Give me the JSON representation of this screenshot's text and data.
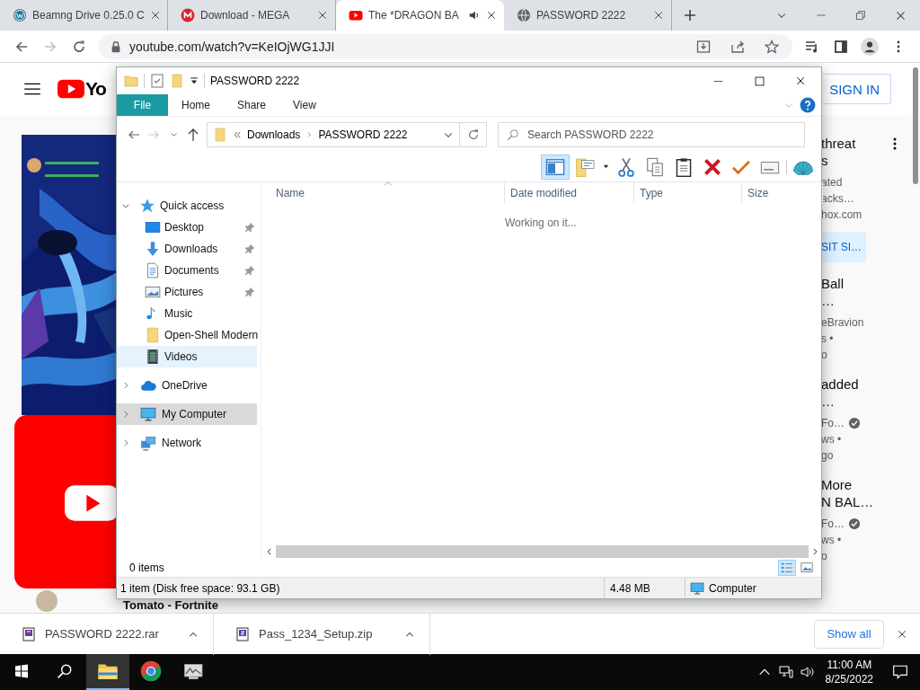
{
  "browser": {
    "tabs": [
      {
        "title": "Beamng Drive 0.25.0 C",
        "selected": false,
        "audio": false
      },
      {
        "title": "Download - MEGA",
        "selected": false,
        "audio": false
      },
      {
        "title": "The *DRAGON BA",
        "selected": true,
        "audio": true
      },
      {
        "title": "PASSWORD 2222",
        "selected": false,
        "audio": false
      }
    ],
    "address": "youtube.com/watch?v=KeIOjWG1JJI"
  },
  "youtube": {
    "logo_text": "Yo",
    "sign_in": "SIGN IN",
    "recommendations": [
      {
        "title": [
          "threat",
          "s"
        ],
        "lines": [
          "ated",
          "acks…",
          "hox.com"
        ],
        "button": "SIT SI…",
        "menu": true
      },
      {
        "title": [
          "Ball",
          "…"
        ],
        "lines": [
          "eBravion",
          "s •",
          "o"
        ]
      },
      {
        "title": [
          "added",
          "…"
        ],
        "lines": [
          "Fo…",
          "ws •",
          "go"
        ],
        "verified": true
      },
      {
        "title": [
          "More",
          "N BAL…"
        ],
        "lines": [
          "Fo…",
          "ws •",
          "o"
        ],
        "verified": true
      }
    ],
    "below_video": "Tomato - Fortnite"
  },
  "explorer": {
    "title": "PASSWORD 2222",
    "ribbon_tabs": [
      {
        "label": "File",
        "selected": true
      },
      {
        "label": "Home",
        "selected": false
      },
      {
        "label": "Share",
        "selected": false
      },
      {
        "label": "View",
        "selected": false
      }
    ],
    "breadcrumb": [
      "Downloads",
      "PASSWORD 2222"
    ],
    "search": {
      "placeholder": "Search PASSWORD 2222"
    },
    "preview_pane": true,
    "nav": [
      {
        "label": "Quick access",
        "expanded": true,
        "selected": false,
        "children": [
          {
            "label": "Desktop",
            "pinned": true,
            "selected": false,
            "hover": false
          },
          {
            "label": "Downloads",
            "pinned": true,
            "selected": false,
            "hover": false
          },
          {
            "label": "Documents",
            "pinned": true,
            "selected": false,
            "hover": false
          },
          {
            "label": "Pictures",
            "pinned": true,
            "selected": false,
            "hover": false
          },
          {
            "label": "Music",
            "pinned": false,
            "selected": false,
            "hover": false
          },
          {
            "label": "Open-Shell Modern",
            "pinned": false,
            "selected": false,
            "hover": false
          },
          {
            "label": "Videos",
            "pinned": false,
            "selected": false,
            "hover": true
          }
        ]
      },
      {
        "label": "OneDrive",
        "expanded": false,
        "selected": false
      },
      {
        "label": "My Computer",
        "expanded": false,
        "selected": true
      },
      {
        "label": "Network",
        "expanded": false,
        "selected": false
      }
    ],
    "columns": [
      "Name",
      "Date modified",
      "Type",
      "Size"
    ],
    "message": "Working on it...",
    "item_count": "0 items",
    "view_buttons": [
      {
        "selected": true
      },
      {
        "selected": false
      }
    ],
    "status": {
      "items": "1 item (Disk free space: 93.1 GB)",
      "size": "4.48 MB",
      "location": "Computer"
    }
  },
  "downloads": {
    "items": [
      {
        "name": "PASSWORD 2222.rar"
      },
      {
        "name": "Pass_1234_Setup.zip"
      }
    ],
    "show_all": "Show all"
  },
  "taskbar": {
    "apps": [
      {
        "kind": "explorer",
        "selected": true
      },
      {
        "kind": "chrome",
        "selected": false
      },
      {
        "kind": "app",
        "selected": false
      }
    ],
    "time": "11:00 AM",
    "date": "8/25/2022"
  }
}
